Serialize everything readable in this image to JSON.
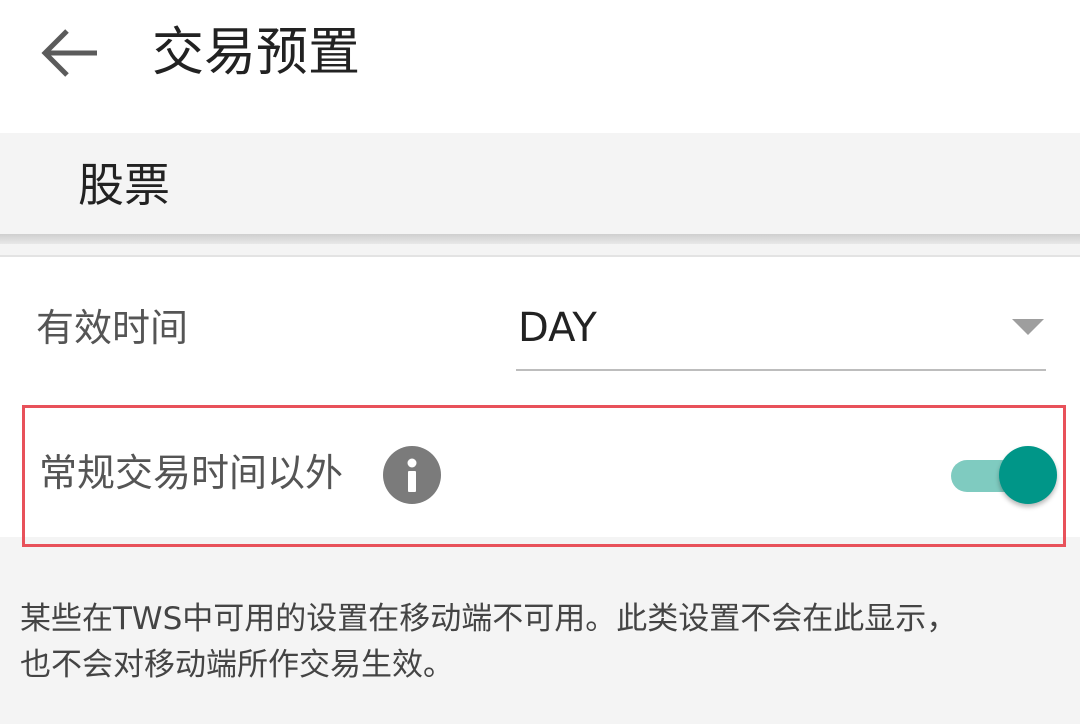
{
  "header": {
    "back_icon": "arrow-left-icon",
    "title": "交易预置"
  },
  "section": {
    "title": "股票"
  },
  "settings": {
    "validity": {
      "label": "有效时间",
      "selected_value": "DAY"
    },
    "extended_hours": {
      "label": "常规交易时间以外",
      "info_icon": "info-icon",
      "enabled": true
    }
  },
  "footnote": {
    "line1": "某些在TWS中可用的设置在移动端不可用。此类设置不会在此显示，",
    "line2": "也不会对移动端所作交易生效。"
  },
  "colors": {
    "accent": "#009688",
    "accent_track": "#7fcbc0",
    "highlight_border": "#e8515a",
    "info_icon_bg": "#7b7b7b",
    "page_bg": "#f4f4f4"
  }
}
